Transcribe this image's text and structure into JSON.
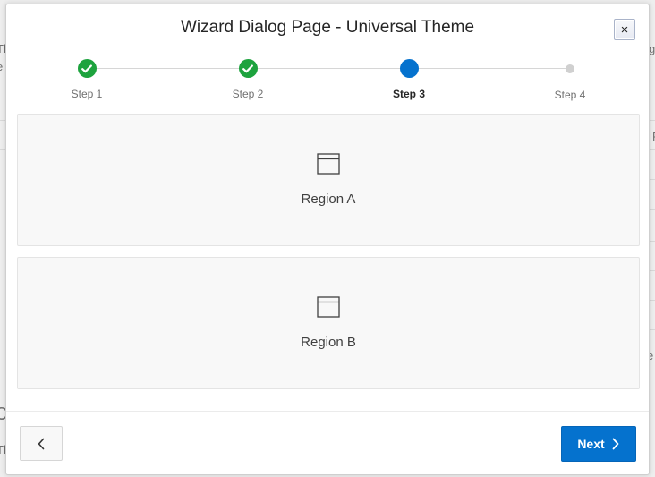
{
  "dialog": {
    "title": "Wizard Dialog Page - Universal Theme",
    "close_label": "×"
  },
  "wizard": {
    "steps": [
      {
        "label": "Step 1",
        "status": "complete"
      },
      {
        "label": "Step 2",
        "status": "complete"
      },
      {
        "label": "Step 3",
        "status": "current"
      },
      {
        "label": "Step 4",
        "status": "future"
      }
    ]
  },
  "regions": [
    {
      "label": "Region A",
      "icon": "window-icon"
    },
    {
      "label": "Region B",
      "icon": "window-icon"
    }
  ],
  "footer": {
    "previous_icon": "chevron-left-icon",
    "next_label": "Next",
    "next_icon": "chevron-right-icon"
  },
  "colors": {
    "complete": "#1da33e",
    "current": "#0572ce",
    "future": "#d0d0d0",
    "primary_button": "#0572ce"
  }
}
